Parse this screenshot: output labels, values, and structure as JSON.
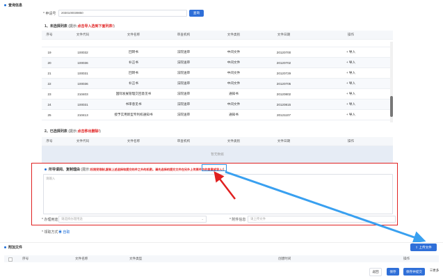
{
  "query_section": {
    "title": "查询信息",
    "order_label": "* 申请号",
    "order_value": "2030100039850",
    "query_button": "查询"
  },
  "table1": {
    "title": "1、未选择列表",
    "hint": "(提示:",
    "hint_red": "点击导入选到下面列表!",
    "hint_end": ")",
    "headers": [
      "序号",
      "文件代码",
      "文件名称",
      "审查机构",
      "文件类别",
      "文件日期",
      "操作"
    ],
    "rows": [
      [
        "19",
        "100032",
        "回转书",
        "法院送审",
        "中间文件",
        "20120700",
        "+ 导入"
      ],
      [
        "20",
        "100036",
        "补正书",
        "法院送审",
        "中间文件",
        "20120702",
        "+ 导入"
      ],
      [
        "21",
        "100031",
        "回转书",
        "法院送审",
        "中间文件",
        "20120729",
        "+ 导入"
      ],
      [
        "22",
        "100036",
        "补正书",
        "法院送审",
        "中间文件",
        "20120705",
        "+ 导入"
      ],
      [
        "23",
        "210403",
        "国际发展管理交回意见书",
        "法院送审",
        "通知书",
        "20120802",
        "+ 导入"
      ],
      [
        "24",
        "100031",
        "书审意见书",
        "法院送审",
        "中间文件",
        "20120815",
        "+ 导入"
      ],
      [
        "25",
        "210413",
        "授予实用新型专利权通知书",
        "法院送审",
        "通知书",
        "20121107",
        "+ 导入"
      ]
    ]
  },
  "table2": {
    "title": "2、已选择列表",
    "hint": "(提示:",
    "hint_red": "点击移出删除!",
    "hint_end": ")",
    "headers": [
      "序号",
      "文件代码",
      "文件名称",
      "审查机构",
      "文件类别",
      "文件日期",
      "操作"
    ],
    "empty_text": "暂无数据"
  },
  "reason_section": {
    "title": "所导请阅、复制理由",
    "hint": "(提示:",
    "hint_red": "权限受限制,复制上述选择和提交的件之外的机密。请先选择的提交文件在另外上传原件中的盖章或导入!",
    "hint_end": ")",
    "textarea_placeholder": "请输入",
    "purpose_label": "* 办理用途",
    "purpose_placeholder": "请选择办理用途",
    "attach_label": "* 附件信息",
    "attach_placeholder": "请上传文件"
  },
  "recv": {
    "label": "* 领取方式",
    "value": "◉ 自取"
  },
  "attach_section": {
    "title": "附加文件",
    "upload_button": "上传文件",
    "headers": [
      "序号",
      "文件名称",
      "文件类型",
      "创建时间",
      "操作"
    ]
  },
  "footer": {
    "back": "返回",
    "save": "保存",
    "submit": "保存并提交",
    "more": "更多"
  }
}
